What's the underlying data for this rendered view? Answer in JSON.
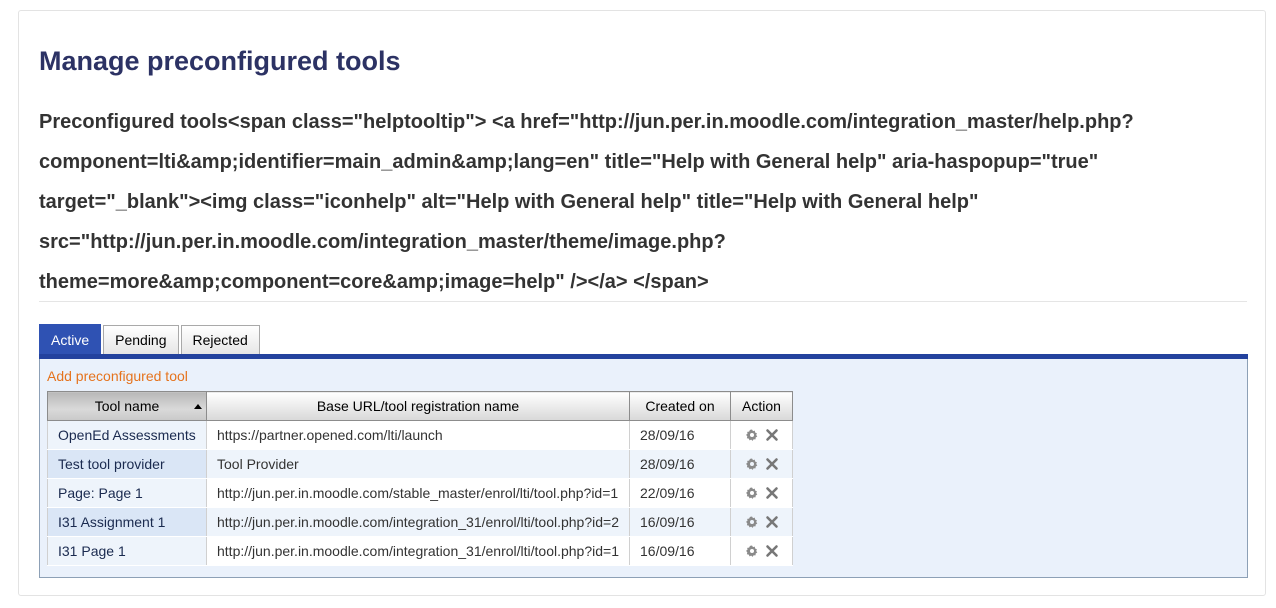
{
  "page_title": "Manage preconfigured tools",
  "section_heading": [
    "Preconfigured tools<span class=\"helptooltip\"> <a href=\"http://jun.per.in.moodle.com/integration_master/help.php?",
    "component=lti&amp;identifier=main_admin&amp;lang=en\" title=\"Help with General help\" aria-haspopup=\"true\"",
    "target=\"_blank\"><img class=\"iconhelp\" alt=\"Help with General help\" title=\"Help with General help\"",
    "src=\"http://jun.per.in.moodle.com/integration_master/theme/image.php?",
    "theme=more&amp;component=core&amp;image=help\" /></a> </span>"
  ],
  "tabs": [
    {
      "label": "Active",
      "active": true
    },
    {
      "label": "Pending",
      "active": false
    },
    {
      "label": "Rejected",
      "active": false
    }
  ],
  "add_link": "Add preconfigured tool",
  "table": {
    "headers": [
      "Tool name",
      "Base URL/tool registration name",
      "Created on",
      "Action"
    ],
    "rows": [
      {
        "name": "OpenEd Assessments",
        "url": "https://partner.opened.com/lti/launch",
        "created": "28/09/16"
      },
      {
        "name": "Test tool provider",
        "url": "Tool Provider",
        "created": "28/09/16"
      },
      {
        "name": "Page: Page 1",
        "url": "http://jun.per.in.moodle.com/stable_master/enrol/lti/tool.php?id=1",
        "created": "22/09/16"
      },
      {
        "name": "I31 Assignment 1",
        "url": "http://jun.per.in.moodle.com/integration_31/enrol/lti/tool.php?id=2",
        "created": "16/09/16"
      },
      {
        "name": "I31 Page 1",
        "url": "http://jun.per.in.moodle.com/integration_31/enrol/lti/tool.php?id=1",
        "created": "16/09/16"
      }
    ],
    "action_icons": [
      "gear-icon",
      "close-icon"
    ]
  },
  "colors": {
    "title": "#2c3264",
    "tab_active": "#2f52b3",
    "link": "#e5731d",
    "panel_bg": "#eaf1fb"
  }
}
